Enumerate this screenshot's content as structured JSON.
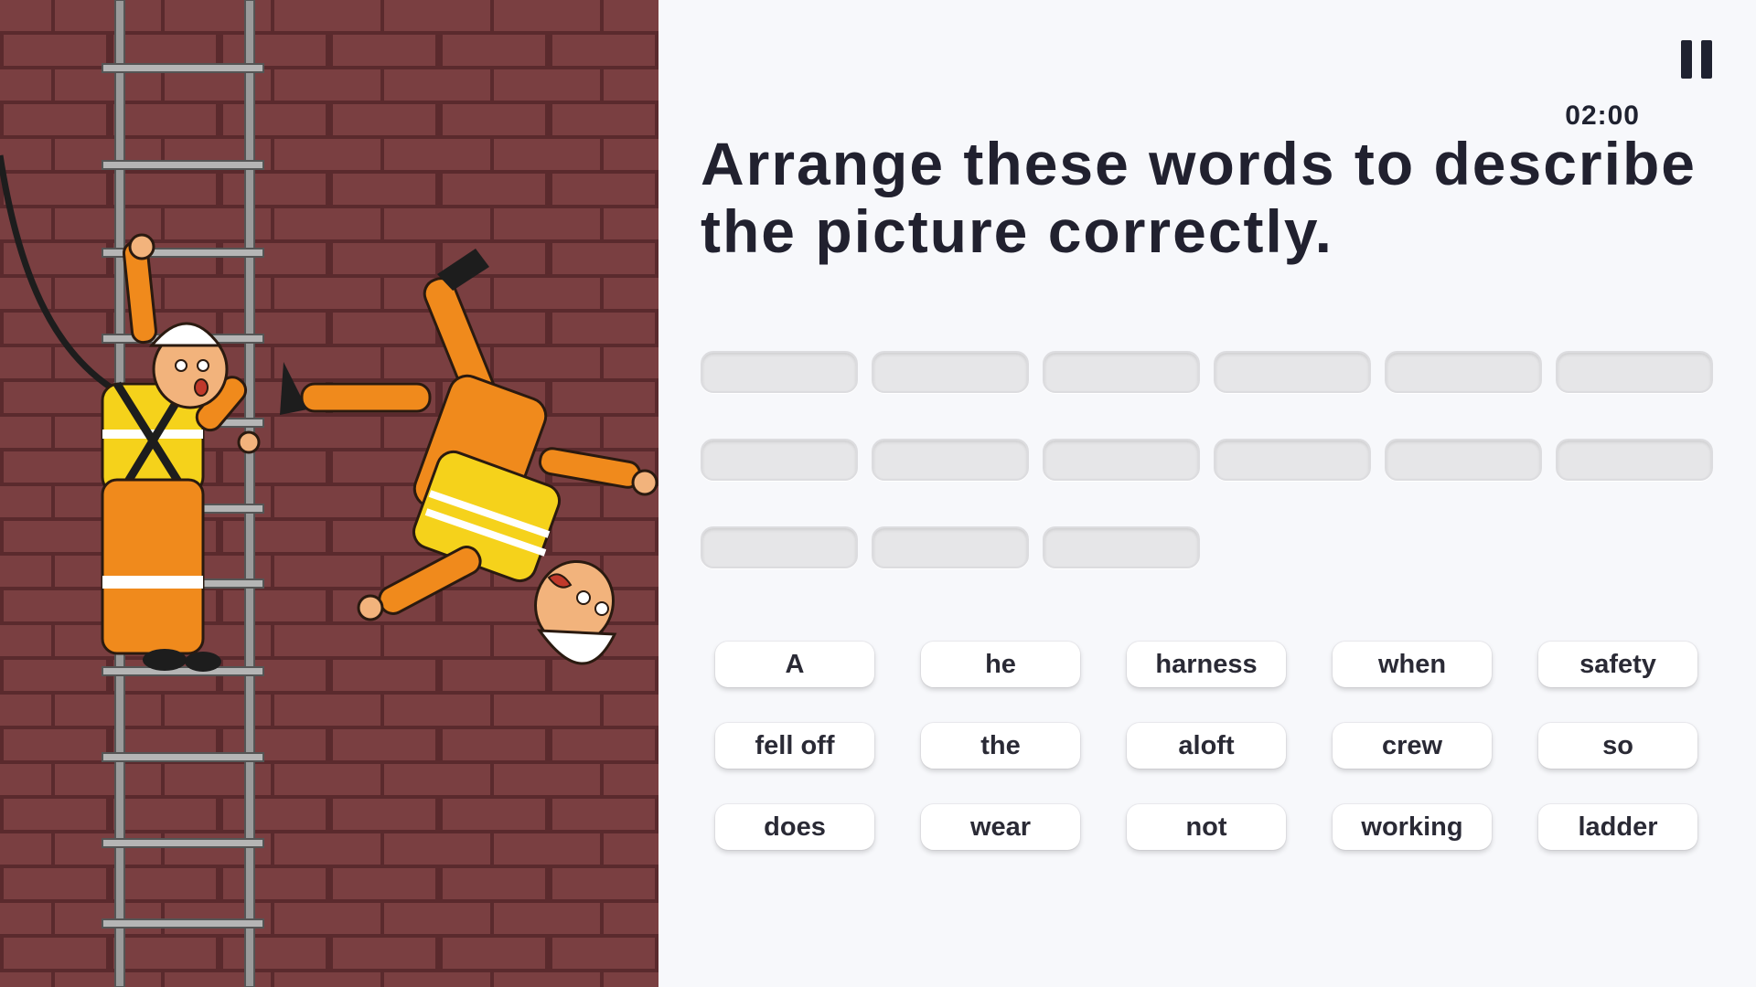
{
  "game": {
    "timer": "02:00",
    "prompt": "Arrange these words to describe the picture correctly.",
    "answer_slot_count": 15,
    "word_bank": [
      "A",
      "he",
      "harness",
      "when",
      "safety",
      "fell off",
      "the",
      "aloft",
      "crew",
      "so",
      "does",
      "wear",
      "not",
      "working",
      "ladder"
    ]
  },
  "icons": {
    "pause": "pause-icon"
  },
  "colors": {
    "brick": "#7a3f41",
    "mortar": "#5a2a2d",
    "uniform": "#f08a1c",
    "vest": "#f5d21b",
    "text": "#21212f"
  }
}
